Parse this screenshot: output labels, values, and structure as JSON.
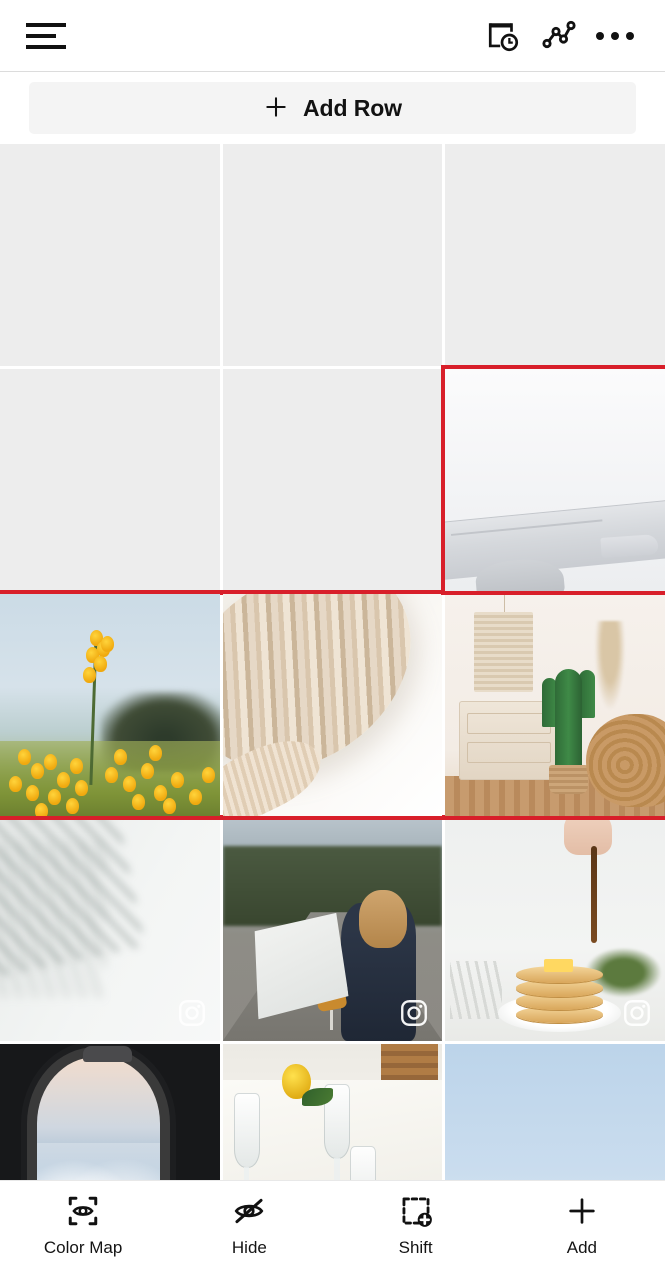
{
  "app": {
    "accent_red": "#d81f2a",
    "empty_cell_color": "#ededed",
    "background": "#ffffff"
  },
  "header": {
    "menu_icon": "hamburger-menu-icon",
    "icons": [
      {
        "name": "schedule-clock-icon",
        "label": "Schedule"
      },
      {
        "name": "analytics-icon",
        "label": "Analytics"
      },
      {
        "name": "more-options-icon",
        "label": "More"
      }
    ]
  },
  "toolbar": {
    "add_row_label": "Add Row",
    "add_row_icon": "plus-icon"
  },
  "grid": {
    "columns": 3,
    "rows": [
      {
        "index": 1,
        "selected": false,
        "cells": [
          {
            "type": "empty",
            "selected": false,
            "art": "empty",
            "alt": "empty placeholder"
          },
          {
            "type": "empty",
            "selected": false,
            "art": "empty",
            "alt": "empty placeholder"
          },
          {
            "type": "empty",
            "selected": false,
            "art": "empty",
            "alt": "empty placeholder"
          }
        ]
      },
      {
        "index": 2,
        "selected": false,
        "cells": [
          {
            "type": "empty",
            "selected": false,
            "art": "empty",
            "alt": "empty placeholder"
          },
          {
            "type": "empty",
            "selected": false,
            "art": "empty",
            "alt": "empty placeholder"
          },
          {
            "type": "photo",
            "selected": true,
            "art": "plane",
            "alt": "airplane wing against white sky"
          }
        ]
      },
      {
        "index": 3,
        "selected": true,
        "cells": [
          {
            "type": "photo",
            "selected": false,
            "art": "flowers",
            "alt": "yellow wildflowers in a field"
          },
          {
            "type": "photo",
            "selected": false,
            "art": "knit",
            "alt": "cream knit blanket with fringe"
          },
          {
            "type": "photo",
            "selected": false,
            "art": "boho",
            "alt": "boho interior with cactus and macrame"
          }
        ]
      },
      {
        "index": 4,
        "selected": false,
        "cells": [
          {
            "type": "photo",
            "selected": false,
            "art": "palmshadow",
            "badge": "instagram-icon",
            "alt": "palm leaf shadow on white wall"
          },
          {
            "type": "photo",
            "selected": false,
            "art": "road",
            "badge": "instagram-icon",
            "alt": "woman reading a map on a mountain road"
          },
          {
            "type": "photo",
            "selected": false,
            "art": "pancake",
            "badge": "instagram-icon",
            "alt": "syrup poured over pancake stack"
          }
        ]
      },
      {
        "index": 5,
        "selected": false,
        "cells": [
          {
            "type": "photo",
            "selected": false,
            "art": "window",
            "alt": "view of clouds through airplane window"
          },
          {
            "type": "photo",
            "selected": false,
            "art": "table",
            "alt": "table setting with lemons and glassware"
          },
          {
            "type": "photo",
            "selected": false,
            "art": "sky",
            "alt": "blue sky with palm fronds"
          }
        ]
      }
    ]
  },
  "bottombar": {
    "items": [
      {
        "label": "Color Map",
        "icon": "color-map-eye-icon"
      },
      {
        "label": "Hide",
        "icon": "eye-off-icon"
      },
      {
        "label": "Shift",
        "icon": "shift-add-icon"
      },
      {
        "label": "Add",
        "icon": "plus-icon"
      }
    ]
  }
}
